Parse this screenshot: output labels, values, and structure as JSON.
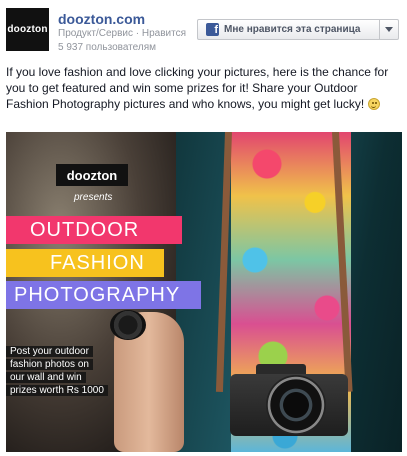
{
  "page": {
    "avatar_text": "doozton",
    "name": "doozton.com",
    "category_line": "Продукт/Сервис · Нравится",
    "fans_line": "5 937 пользователям"
  },
  "like_button": {
    "icon": "facebook-f-icon",
    "label": "Мне нравится эта страница",
    "dropdown_icon": "chevron-down-icon"
  },
  "post": {
    "text": "If you love fashion and love clicking your pictures, here is the chance for you to get featured and win some prizes for it! Share your Outdoor Fashion Photography pictures and who knows, you might get lucky!",
    "emoticon": "smiley-icon"
  },
  "photo": {
    "logo": "doozton",
    "presents": "presents",
    "line1": "OUTDOOR",
    "line2": "FASHION",
    "line3": "PHOTOGRAPHY",
    "cta_lines": [
      "Post your outdoor",
      "fashion photos on",
      "our wall and win",
      "prizes worth Rs 1000"
    ],
    "colors": {
      "pink": "#f2376d",
      "yellow": "#f7c21e",
      "purple": "#7e74e6"
    }
  }
}
